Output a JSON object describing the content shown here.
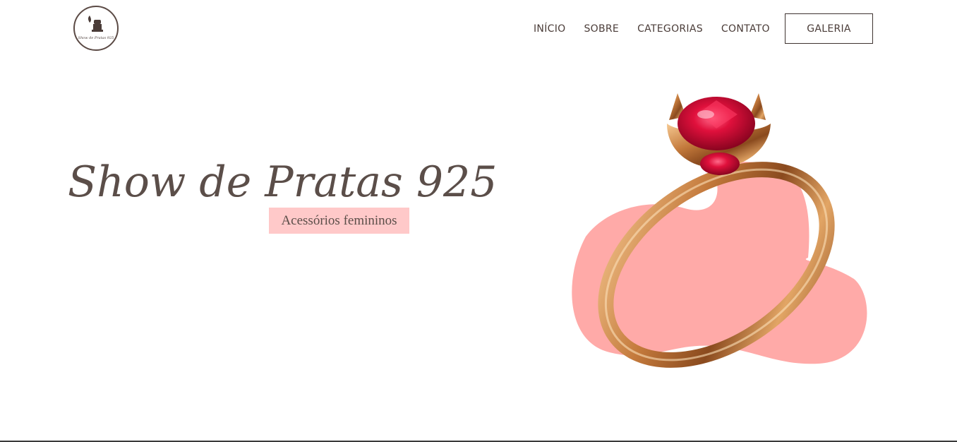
{
  "header": {
    "logo": {
      "icon": "jewelry-box-logo-icon",
      "caption": "Show de Pratas 925"
    },
    "nav": [
      {
        "label": "INÍCIO"
      },
      {
        "label": "SOBRE"
      },
      {
        "label": "CATEGORIAS"
      },
      {
        "label": "CONTATO"
      }
    ],
    "gallery_button": "GALERIA"
  },
  "hero": {
    "title": "Show de Pratas 925",
    "subtitle": "Acessórios femininos",
    "image_icon": "ruby-ring-icon"
  },
  "colors": {
    "text": "#5b4e49",
    "subtitle_bg": "#ffc9c9",
    "blob": "#ffaaa8",
    "gold": "#c98a4e",
    "ruby": "#d8123f"
  }
}
